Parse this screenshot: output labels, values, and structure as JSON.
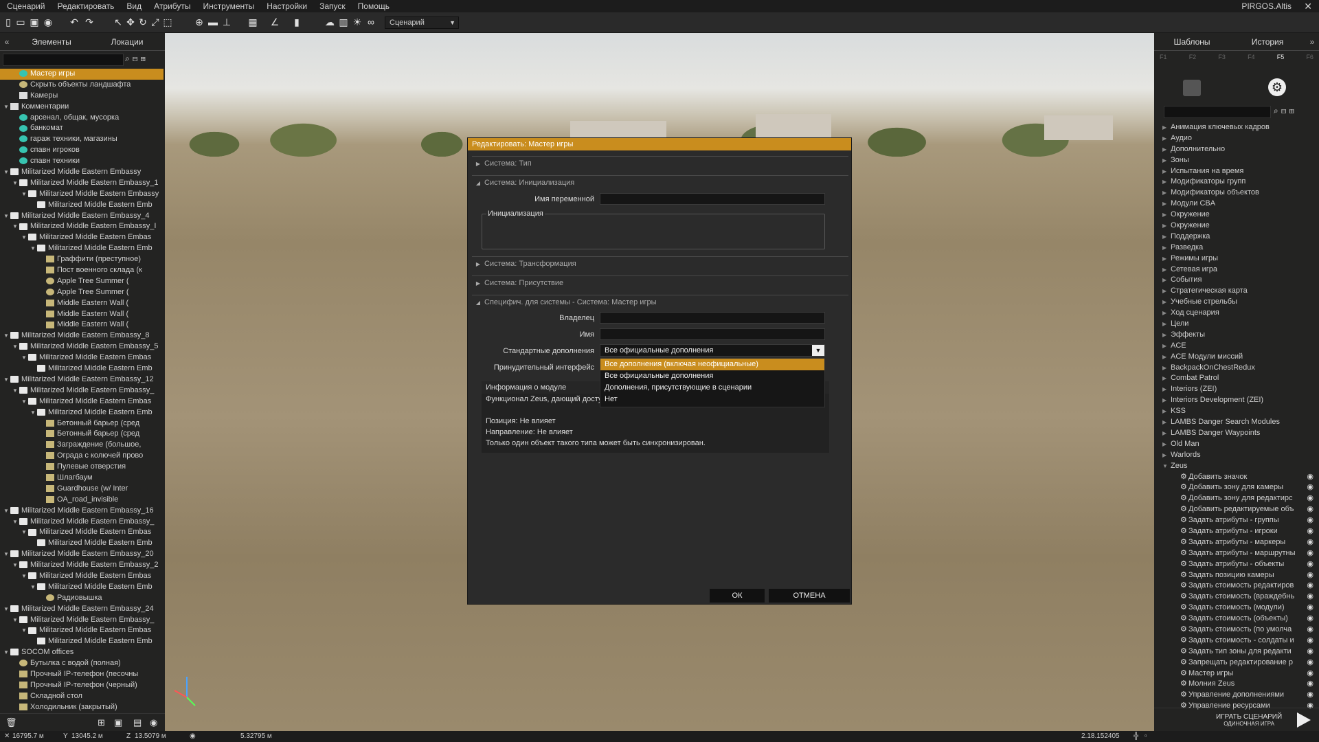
{
  "menubar": {
    "items": [
      "Сценарий",
      "Редактировать",
      "Вид",
      "Атрибуты",
      "Инструменты",
      "Настройки",
      "Запуск",
      "Помощь"
    ],
    "map_name": "PIRGOS.Altis",
    "close": "✕"
  },
  "toolbar": {
    "mode_combo": "Сценарий"
  },
  "left_panel": {
    "tabs": [
      "Элементы",
      "Локации"
    ],
    "rows": [
      {
        "text": "Мастер игры",
        "indent": 2,
        "icon": "cmt",
        "sel": true
      },
      {
        "text": "Скрыть объекты ландшафта",
        "indent": 2,
        "icon": "circ"
      },
      {
        "text": "Камеры",
        "indent": 2,
        "icon": "chk"
      },
      {
        "text": "Комментарии",
        "indent": 1,
        "icon": "chk",
        "exp": "▼"
      },
      {
        "text": "арсенал, общак, мусорка",
        "indent": 2,
        "icon": "cmt"
      },
      {
        "text": "банкомат",
        "indent": 2,
        "icon": "cmt"
      },
      {
        "text": "гараж техники, магазины",
        "indent": 2,
        "icon": "cmt"
      },
      {
        "text": "спавн игроков",
        "indent": 2,
        "icon": "cmt"
      },
      {
        "text": "спавн техники",
        "indent": 2,
        "icon": "cmt"
      },
      {
        "text": "Militarized Middle Eastern Embassy",
        "indent": 1,
        "icon": "folder",
        "exp": "▼"
      },
      {
        "text": "Militarized Middle Eastern Embassy_1",
        "indent": 2,
        "icon": "folder",
        "exp": "▼"
      },
      {
        "text": "Militarized Middle Eastern Embassy",
        "indent": 3,
        "icon": "folder",
        "exp": "▼"
      },
      {
        "text": "Militarized Middle Eastern Emb",
        "indent": 4,
        "icon": "folder"
      },
      {
        "text": "Militarized Middle Eastern Embassy_4",
        "indent": 1,
        "icon": "folder",
        "exp": "▼"
      },
      {
        "text": "Militarized Middle Eastern Embassy_I",
        "indent": 2,
        "icon": "folder",
        "exp": "▼"
      },
      {
        "text": "Militarized Middle Eastern Embas",
        "indent": 3,
        "icon": "folder",
        "exp": "▼"
      },
      {
        "text": "Militarized Middle Eastern Emb",
        "indent": 4,
        "icon": "folder",
        "exp": "▼"
      },
      {
        "text": "Граффити (преступное)",
        "indent": 5,
        "icon": "line"
      },
      {
        "text": "Пост военного склада (к",
        "indent": 5,
        "icon": "obj"
      },
      {
        "text": "Apple Tree Summer (",
        "indent": 5,
        "icon": "circ"
      },
      {
        "text": "Apple Tree Summer (",
        "indent": 5,
        "icon": "circ"
      },
      {
        "text": "Middle Eastern Wall (",
        "indent": 5,
        "icon": "line"
      },
      {
        "text": "Middle Eastern Wall (",
        "indent": 5,
        "icon": "line"
      },
      {
        "text": "Middle Eastern Wall (",
        "indent": 5,
        "icon": "line"
      },
      {
        "text": "Militarized Middle Eastern Embassy_8",
        "indent": 1,
        "icon": "folder",
        "exp": "▼"
      },
      {
        "text": "Militarized Middle Eastern Embassy_5",
        "indent": 2,
        "icon": "folder",
        "exp": "▼"
      },
      {
        "text": "Militarized Middle Eastern Embas",
        "indent": 3,
        "icon": "folder",
        "exp": "▼"
      },
      {
        "text": "Militarized Middle Eastern Emb",
        "indent": 4,
        "icon": "folder"
      },
      {
        "text": "Militarized Middle Eastern Embassy_12",
        "indent": 1,
        "icon": "folder",
        "exp": "▼"
      },
      {
        "text": "Militarized Middle Eastern Embassy_",
        "indent": 2,
        "icon": "folder",
        "exp": "▼"
      },
      {
        "text": "Militarized Middle Eastern Embas",
        "indent": 3,
        "icon": "folder",
        "exp": "▼"
      },
      {
        "text": "Militarized Middle Eastern Emb",
        "indent": 4,
        "icon": "folder",
        "exp": "▼"
      },
      {
        "text": "Бетонный барьер (сред",
        "indent": 5,
        "icon": "obj"
      },
      {
        "text": "Бетонный барьер (сред",
        "indent": 5,
        "icon": "obj"
      },
      {
        "text": "Заграждение (большое,",
        "indent": 5,
        "icon": "obj"
      },
      {
        "text": "Ограда с колючей прово",
        "indent": 5,
        "icon": "line"
      },
      {
        "text": "Пулевые отверстия",
        "indent": 5,
        "icon": "obj"
      },
      {
        "text": "Шлагбаум",
        "indent": 5,
        "icon": "line"
      },
      {
        "text": "Guardhouse (w/ Inter",
        "indent": 5,
        "icon": "obj"
      },
      {
        "text": "OA_road_invisible",
        "indent": 5,
        "icon": "line"
      },
      {
        "text": "Militarized Middle Eastern Embassy_16",
        "indent": 1,
        "icon": "folder",
        "exp": "▼"
      },
      {
        "text": "Militarized Middle Eastern Embassy_",
        "indent": 2,
        "icon": "folder",
        "exp": "▼"
      },
      {
        "text": "Militarized Middle Eastern Embas",
        "indent": 3,
        "icon": "folder",
        "exp": "▼"
      },
      {
        "text": "Militarized Middle Eastern Emb",
        "indent": 4,
        "icon": "folder"
      },
      {
        "text": "Militarized Middle Eastern Embassy_20",
        "indent": 1,
        "icon": "folder",
        "exp": "▼"
      },
      {
        "text": "Militarized Middle Eastern Embassy_2",
        "indent": 2,
        "icon": "folder",
        "exp": "▼"
      },
      {
        "text": "Militarized Middle Eastern Embas",
        "indent": 3,
        "icon": "folder",
        "exp": "▼"
      },
      {
        "text": "Militarized Middle Eastern Emb",
        "indent": 4,
        "icon": "folder",
        "exp": "▼"
      },
      {
        "text": "Радиовышка",
        "indent": 5,
        "icon": "circ"
      },
      {
        "text": "Militarized Middle Eastern Embassy_24",
        "indent": 1,
        "icon": "folder",
        "exp": "▼"
      },
      {
        "text": "Militarized Middle Eastern Embassy_",
        "indent": 2,
        "icon": "folder",
        "exp": "▼"
      },
      {
        "text": "Militarized Middle Eastern Embas",
        "indent": 3,
        "icon": "folder",
        "exp": "▼"
      },
      {
        "text": "Militarized Middle Eastern Emb",
        "indent": 4,
        "icon": "folder"
      },
      {
        "text": "SOCOM offices",
        "indent": 1,
        "icon": "folder",
        "exp": "▼"
      },
      {
        "text": "Бутылка с водой (полная)",
        "indent": 2,
        "icon": "circ"
      },
      {
        "text": "Прочный IP-телефон (песочны",
        "indent": 2,
        "icon": "obj"
      },
      {
        "text": "Прочный IP-телефон (черный)",
        "indent": 2,
        "icon": "obj"
      },
      {
        "text": "Складной стол",
        "indent": 2,
        "icon": "line"
      },
      {
        "text": "Холодильник (закрытый)",
        "indent": 2,
        "icon": "obj"
      }
    ]
  },
  "right_panel": {
    "tabs": [
      "Шаблоны",
      "История"
    ],
    "fkeys": [
      "F1",
      "F2",
      "F3",
      "F4",
      "F5",
      "F6"
    ],
    "categories": [
      "Анимация ключевых кадров",
      "Аудио",
      "Дополнительно",
      "Зоны",
      "Испытания на время",
      "Модификаторы групп",
      "Модификаторы объектов",
      "Модули CBA",
      "Окружение",
      "Окружение",
      "Поддержка",
      "Разведка",
      "Режимы игры",
      "Сетевая игра",
      "События",
      "Стратегическая карта",
      "Учебные стрельбы",
      "Ход сценария",
      "Цели",
      "Эффекты",
      "ACE",
      "ACE Модули миссий",
      "BackpackOnChestRedux",
      "Combat Patrol",
      "Interiors (ZEI)",
      "Interiors Development (ZEI)",
      "KSS",
      "LAMBS Danger Search Modules",
      "LAMBS Danger Waypoints",
      "Old Man",
      "Warlords",
      "Zeus"
    ],
    "zeus_items": [
      "Добавить значок",
      "Добавить зону для камеры",
      "Добавить зону для редактирс",
      "Добавить редактируемые объ",
      "Задать атрибуты - группы",
      "Задать атрибуты - игроки",
      "Задать атрибуты - маркеры",
      "Задать атрибуты - маршрутны",
      "Задать атрибуты - объекты",
      "Задать позицию камеры",
      "Задать стоимость редактиров",
      "Задать стоимость (враждебнь",
      "Задать стоимость (модули)",
      "Задать стоимость (объекты)",
      "Задать стоимость (по умолча",
      "Задать стоимость - солдаты и",
      "Задать тип зоны для редакти",
      "Запрещать редактирование р",
      "Мастер игры",
      "Молния Zeus",
      "Управление дополнениями",
      "Управление ресурсами"
    ],
    "play_label_1": "ИГРАТЬ СЦЕНАРИЙ",
    "play_label_2": "ОДИНОЧНАЯ ИГРА"
  },
  "status": {
    "x": "16795.7 м",
    "y": "13045.2 м",
    "z": "13.5079 м",
    "dist": "5.32795 м",
    "version": "2.18.152405"
  },
  "dialog": {
    "title": "Редактировать: Мастер игры",
    "sections": {
      "type": "Система: Тип",
      "init": "Система: Инициализация",
      "transform": "Система: Трансформация",
      "presence": "Система: Присутствие",
      "specific": "Специфич. для системы - Система: Мастер игры"
    },
    "var_name_label": "Имя переменной",
    "init_label": "Инициализация",
    "owner_label": "Владелец",
    "name_label": "Имя",
    "addons_label": "Стандартные дополнения",
    "addons_value": "Все официальные дополнения",
    "forced_label": "Принудительный интерфейс",
    "addons_options": [
      "Все дополнения (включая неофициальные)",
      "Все официальные дополнения",
      "Дополнения, присутствующие в сценарии",
      "Нет"
    ],
    "info_header": "Информация о модуле",
    "info_lines": [
      "Функционал Zeus, дающий доступ",
      "",
      "Позиция: Не влияет",
      "Направление: Не влияет",
      "Только один объект такого типа может быть синхронизирован."
    ],
    "ok": "ОК",
    "cancel": "ОТМЕНА"
  },
  "colors": {
    "accent": "#c98d1e",
    "panel": "#1e1e1e"
  }
}
